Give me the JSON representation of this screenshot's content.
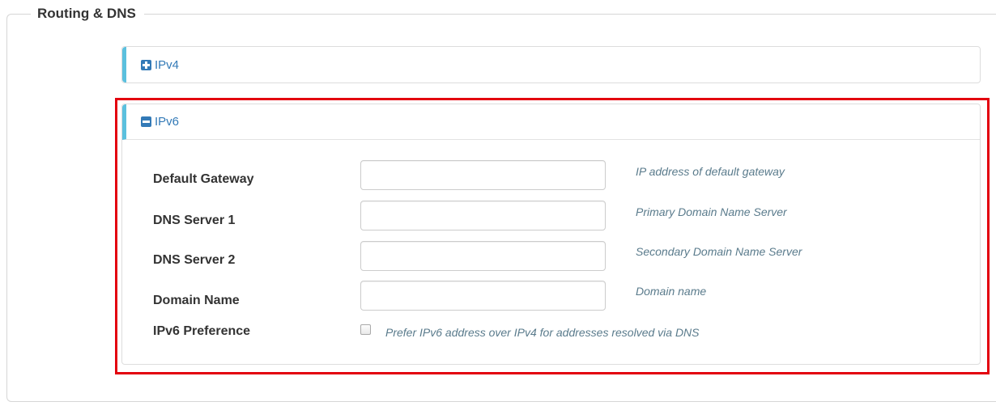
{
  "section": {
    "title": "Routing & DNS"
  },
  "ipv4_panel": {
    "title": "IPv4",
    "state": "collapsed"
  },
  "ipv6_panel": {
    "title": "IPv6",
    "state": "expanded",
    "fields": {
      "default_gateway": {
        "label": "Default Gateway",
        "value": "",
        "help": "IP address of default gateway"
      },
      "dns_server_1": {
        "label": "DNS Server 1",
        "value": "",
        "help": "Primary Domain Name Server"
      },
      "dns_server_2": {
        "label": "DNS Server 2",
        "value": "",
        "help": "Secondary Domain Name Server"
      },
      "domain_name": {
        "label": "Domain Name",
        "value": "",
        "help": "Domain name"
      },
      "ipv6_preference": {
        "label": "IPv6 Preference",
        "checked": false,
        "help": "Prefer IPv6 address over IPv4 for addresses resolved via DNS"
      }
    }
  },
  "colors": {
    "accent": "#337ab7",
    "panel_indicator": "#5bc0de",
    "help_text": "#5a7b8c",
    "highlight_box": "#e3000f"
  }
}
